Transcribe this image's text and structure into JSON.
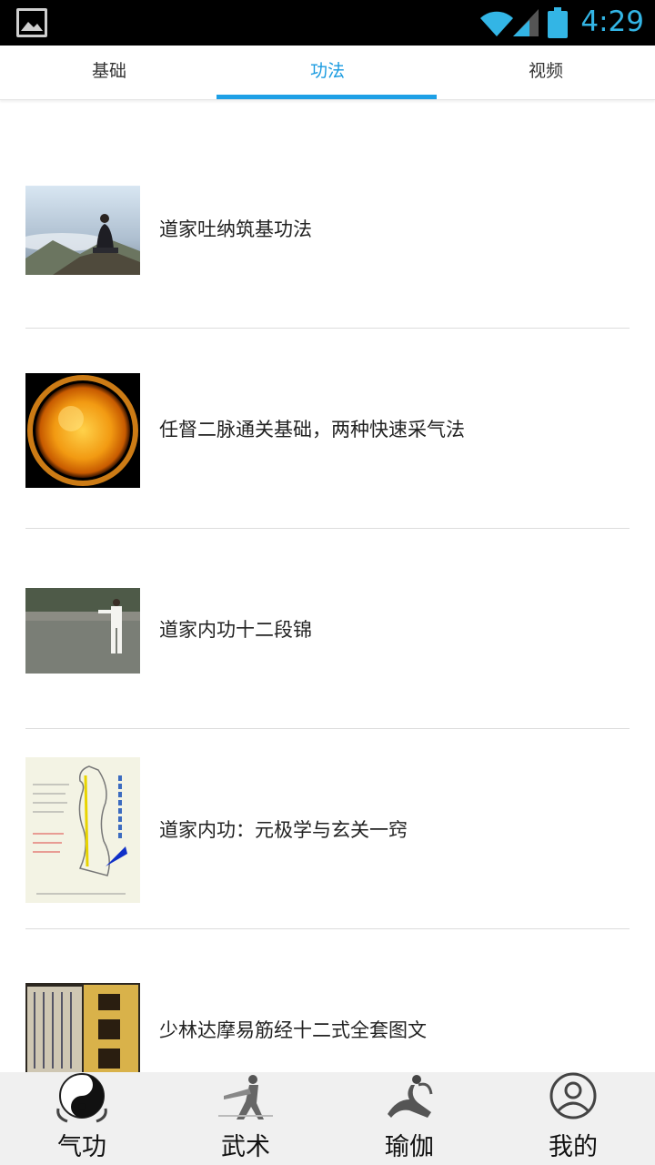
{
  "status_bar": {
    "time": "4:29"
  },
  "tabs": [
    {
      "label": "基础",
      "active": false
    },
    {
      "label": "功法",
      "active": true
    },
    {
      "label": "视频",
      "active": false
    }
  ],
  "list": [
    {
      "title": "道家吐纳筑基功法",
      "thumb": "meditation-mountain-photo"
    },
    {
      "title": "任督二脉通关基础，两种快速采气法",
      "thumb": "glowing-orb-photo"
    },
    {
      "title": "道家内功十二段锦",
      "thumb": "martial-artist-photo"
    },
    {
      "title": "道家内功：元极学与玄关一窍",
      "thumb": "meridian-diagram-photo"
    },
    {
      "title": "少林达摩易筋经十二式全套图文",
      "thumb": "ancient-book-photo"
    }
  ],
  "bottom_nav": [
    {
      "label": "气功",
      "icon": "yin-yang-icon"
    },
    {
      "label": "武术",
      "icon": "martial-arts-icon"
    },
    {
      "label": "瑜伽",
      "icon": "yoga-icon"
    },
    {
      "label": "我的",
      "icon": "user-icon"
    }
  ],
  "colors": {
    "accent": "#1ea0e6",
    "clock": "#33b5e5"
  }
}
